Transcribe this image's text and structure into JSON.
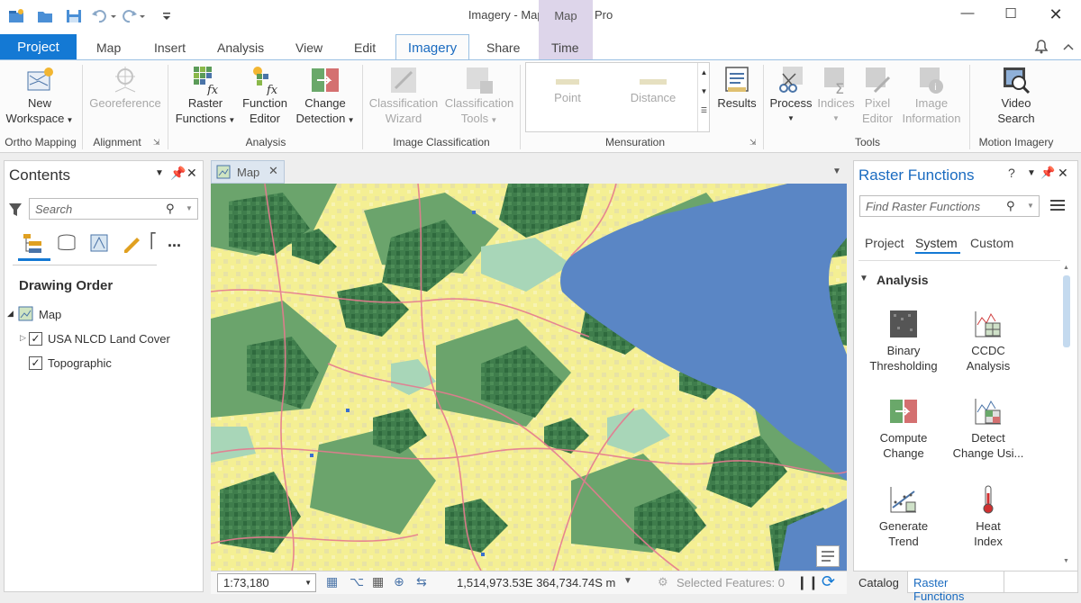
{
  "app": {
    "title": "Imagery - Map - ArcGIS Pro",
    "context_header": "Map"
  },
  "tabs": {
    "project": "Project",
    "map": "Map",
    "insert": "Insert",
    "analysis": "Analysis",
    "view": "View",
    "edit": "Edit",
    "imagery": "Imagery",
    "share": "Share",
    "time": "Time"
  },
  "ribbon": {
    "new_workspace": [
      "New",
      "Workspace"
    ],
    "georeference": "Georeference",
    "raster_functions": [
      "Raster",
      "Functions"
    ],
    "function_editor": [
      "Function",
      "Editor"
    ],
    "change_detection": [
      "Change",
      "Detection"
    ],
    "classification_wizard": [
      "Classification",
      "Wizard"
    ],
    "classification_tools": [
      "Classification",
      "Tools"
    ],
    "point": "Point",
    "distance": "Distance",
    "results": "Results",
    "process": "Process",
    "indices": "Indices",
    "pixel_editor": [
      "Pixel",
      "Editor"
    ],
    "image_information": [
      "Image",
      "Information"
    ],
    "video_search": [
      "Video",
      "Search"
    ],
    "groups": {
      "ortho_mapping": "Ortho Mapping",
      "alignment": "Alignment",
      "analysis": "Analysis",
      "image_classification": "Image Classification",
      "mensuration": "Mensuration",
      "tools": "Tools",
      "motion_imagery": "Motion Imagery"
    }
  },
  "contents": {
    "title": "Contents",
    "search_placeholder": "Search",
    "drawing_order": "Drawing Order",
    "layers": [
      {
        "name": "Map"
      },
      {
        "name": "USA NLCD Land Cover",
        "checked": true
      },
      {
        "name": "Topographic",
        "checked": true
      }
    ]
  },
  "map": {
    "tab": "Map",
    "scale": "1:73,180",
    "coords": "1,514,973.53E 364,734.74S m",
    "selected": "Selected Features: 0"
  },
  "raster_functions": {
    "title": "Raster Functions",
    "search_placeholder": "Find Raster Functions",
    "tabs": [
      "Project",
      "System",
      "Custom"
    ],
    "active_tab": "System",
    "section": "Analysis",
    "items": [
      [
        "Binary",
        "Thresholding"
      ],
      [
        "CCDC",
        "Analysis"
      ],
      [
        "Compute",
        "Change"
      ],
      [
        "Detect",
        "Change Usi..."
      ],
      [
        "Generate",
        "Trend"
      ],
      [
        "Heat",
        "Index"
      ]
    ],
    "bottom_tabs": [
      "Catalog",
      "Raster Functions"
    ]
  },
  "colors": {
    "accent": "#1479d4",
    "water": "#5a86c5",
    "forest": "#3f7d4c",
    "forest_light": "#6ba46c",
    "crop": "#f4ef93",
    "pasture": "#e7e2a8",
    "road": "#e67a8f"
  }
}
